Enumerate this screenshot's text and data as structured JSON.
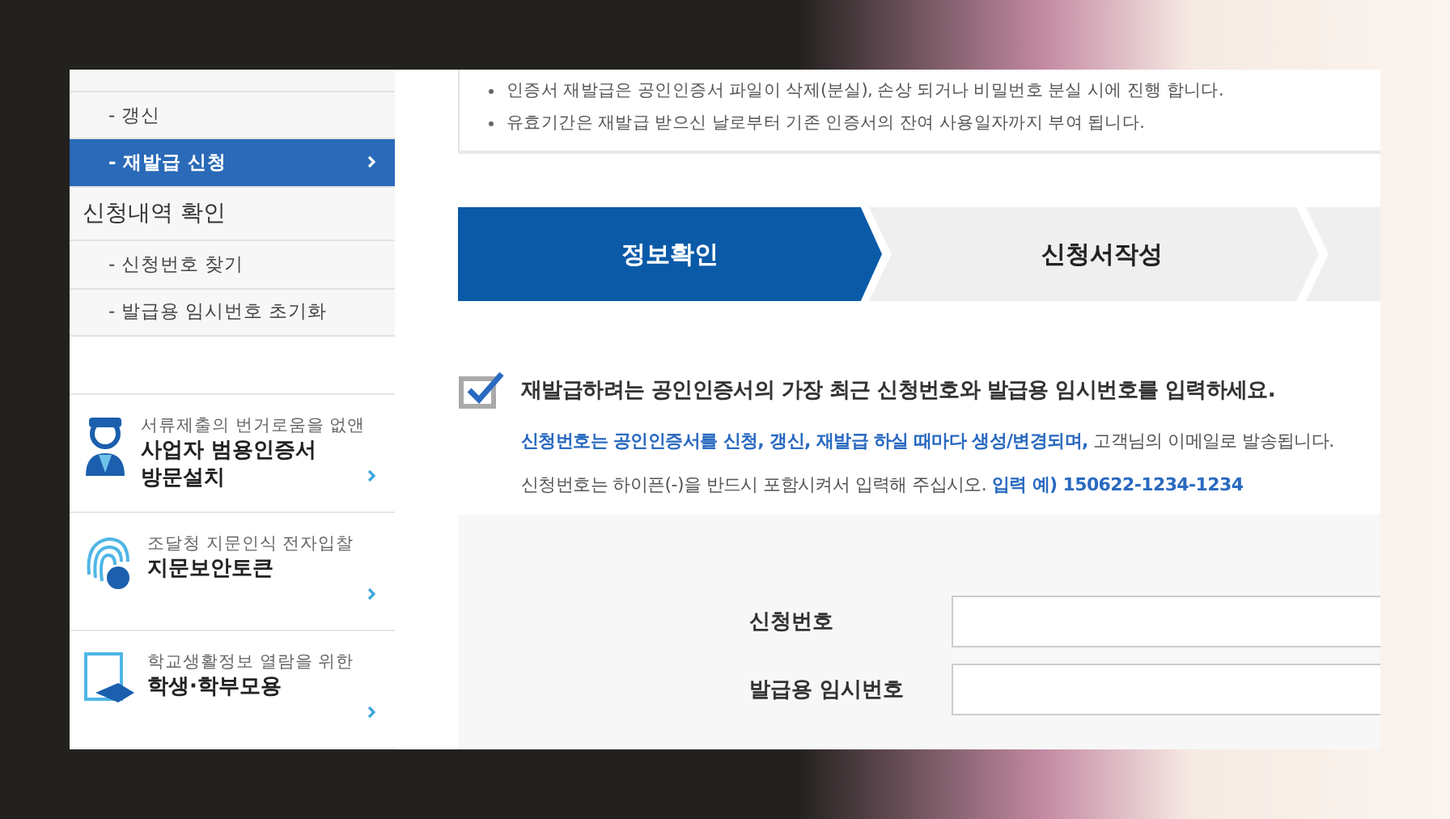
{
  "sidebar": {
    "items": [
      {
        "label": "- 갱신",
        "kind": "sub",
        "selected": false
      },
      {
        "label": "- 재발급 신청",
        "kind": "sub",
        "selected": true
      },
      {
        "label": "신청내역 확인",
        "kind": "main",
        "selected": false
      },
      {
        "label": "- 신청번호 찾기",
        "kind": "sub",
        "selected": false
      },
      {
        "label": "- 발급용 임시번호 초기화",
        "kind": "sub",
        "selected": false
      }
    ],
    "promos": [
      {
        "kind": "worker",
        "caption": "서류제출의 번거로움을 없앤",
        "title": [
          "사업자 범용인증서",
          "방문설치"
        ]
      },
      {
        "kind": "fingerprint",
        "caption": "조달청 지문인식 전자입찰",
        "title": [
          "지문보안토큰"
        ]
      },
      {
        "kind": "student",
        "caption": "학교생활정보 열람을 위한",
        "title": [
          "학생·학부모용"
        ]
      }
    ]
  },
  "notice": {
    "bullets": [
      "인증서 재발급은 공인인증서 파일이 삭제(분실), 손상 되거나 비밀번호 분실 시에 진행 합니다.",
      "유효기간은 재발급 받으신 날로부터 기존 인증서의 잔여 사용일자까지 부여 됩니다."
    ]
  },
  "steps": [
    {
      "label": "정보확인",
      "selected": true
    },
    {
      "label": "신청서작성",
      "selected": false
    },
    {
      "selected": false
    }
  ],
  "instruction": {
    "heading": "재발급하려는 공인인증서의 가장 최근 신청번호와 발급용 임시번호를 입력하세요.",
    "line_1": "**신청번호는 공인인증서를 신청, 갱신, 재발급 하실 때마다 생성/변경되며,** 고객님의 이메일로 발송됩니다.",
    "line_2": "신청번호는 하이픈(-)을 반드시 포함시켜서 입력해 주십시오. **입력 예) 150622-1234-1234**"
  },
  "form": {
    "fields": [
      {
        "label": "신청번호"
      },
      {
        "label": "발급용 임시번호"
      }
    ]
  }
}
